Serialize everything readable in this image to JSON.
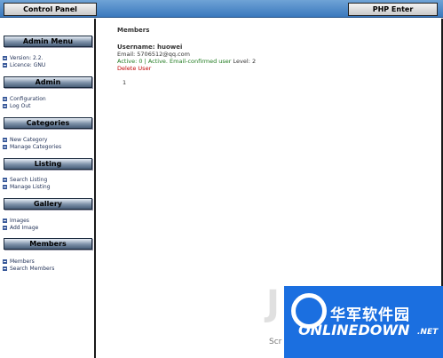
{
  "topbar": {
    "control_panel_label": "Control Panel",
    "php_enter_label": "PHP Enter"
  },
  "sidebar": {
    "sections": [
      {
        "title": "Admin Menu",
        "items": [
          "Version: 2.2.",
          "Licence: GNU"
        ]
      },
      {
        "title": "Admin",
        "items": [
          "Configuration",
          "Log Out"
        ]
      },
      {
        "title": "Categories",
        "items": [
          "New Category",
          "Manage Categories"
        ]
      },
      {
        "title": "Listing",
        "items": [
          "Search Listing",
          "Manage Listing"
        ]
      },
      {
        "title": "Gallery",
        "items": [
          "Images",
          "Add Image"
        ]
      },
      {
        "title": "Members",
        "items": [
          "Members",
          "Search Members"
        ]
      }
    ]
  },
  "main": {
    "title": "Members",
    "username": "Username: huowei",
    "email": "Email: 5706512@qq.com",
    "status": "Active: 0 | Active. Email-confirmed user",
    "level": "Level: 2",
    "delete_label": "Delete User",
    "page_number": "1"
  },
  "watermark": {
    "partial_letter": "J",
    "partial_text": "Scr",
    "cn_text": "华军软件园",
    "en_text": "ONLINEDOWN",
    "net_text": ".NET"
  },
  "colors": {
    "topbar": "#3a78bd",
    "header": "#4a5f7a",
    "link": "#1f2f55",
    "status": "#1f7a1f",
    "delete": "#c00000",
    "watermark": "#1b6fe0"
  }
}
